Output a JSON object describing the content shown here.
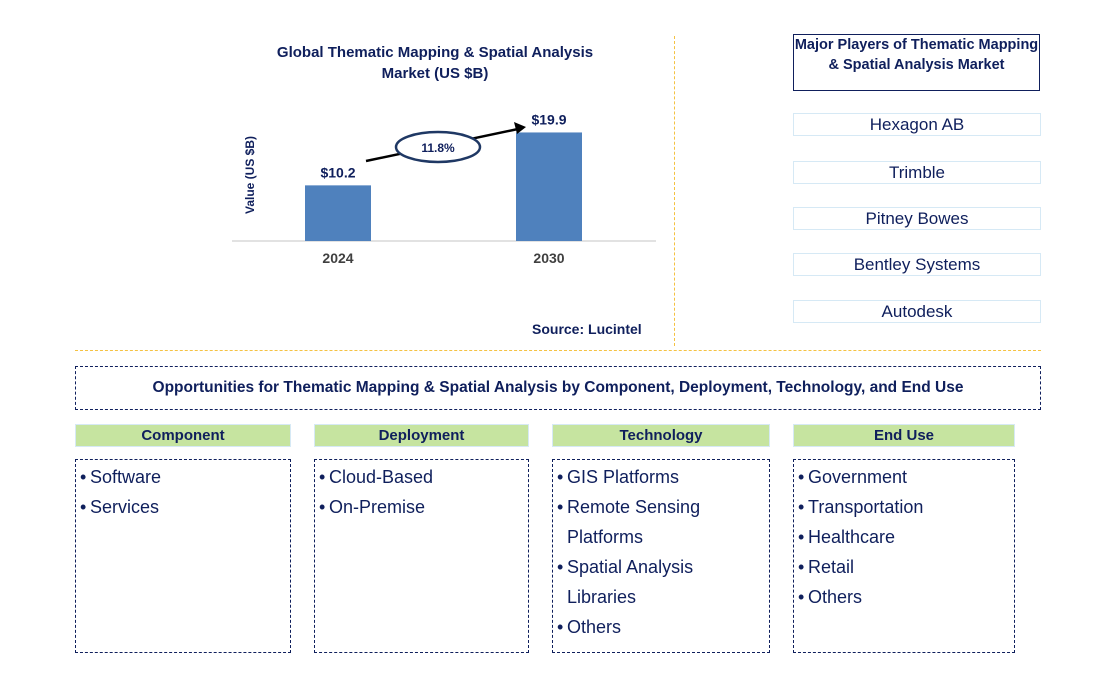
{
  "chart_data": {
    "type": "bar",
    "title": "Global Thematic Mapping & Spatial Analysis Market (US $B)",
    "xlabel": "",
    "ylabel": "Value (US $B)",
    "categories": [
      "2024",
      "2030"
    ],
    "values": [
      10.2,
      19.9
    ],
    "data_labels": [
      "$10.2",
      "$19.9"
    ],
    "ylim": [
      0,
      22
    ],
    "grid": false,
    "bar_color": "#4f81bd",
    "annotation": {
      "text": "11.8%",
      "type": "CAGR arrow"
    },
    "source": "Source: Lucintel"
  },
  "players": {
    "title": "Major Players of Thematic Mapping & Spatial Analysis Market",
    "items": [
      "Hexagon AB",
      "Trimble",
      "Pitney Bowes",
      "Bentley Systems",
      "Autodesk"
    ]
  },
  "opportunities": {
    "banner": "Opportunities for Thematic Mapping & Spatial Analysis by Component, Deployment, Technology, and End Use",
    "segments": [
      {
        "title": "Component",
        "items": [
          [
            "Software"
          ],
          [
            "Services"
          ]
        ]
      },
      {
        "title": "Deployment",
        "items": [
          [
            "Cloud-Based"
          ],
          [
            "On-Premise"
          ]
        ]
      },
      {
        "title": "Technology",
        "items": [
          [
            "GIS Platforms"
          ],
          [
            "Remote Sensing",
            "Platforms"
          ],
          [
            "Spatial Analysis",
            "Libraries"
          ],
          [
            "Others"
          ]
        ]
      },
      {
        "title": "End Use",
        "items": [
          [
            "Government"
          ],
          [
            "Transportation"
          ],
          [
            "Healthcare"
          ],
          [
            "Retail"
          ],
          [
            "Others"
          ]
        ]
      }
    ]
  },
  "colors": {
    "text": "#0f1f5c",
    "bar": "#4f81bd",
    "segment_header": "#c6e4a0",
    "divider": "#f5c242"
  }
}
